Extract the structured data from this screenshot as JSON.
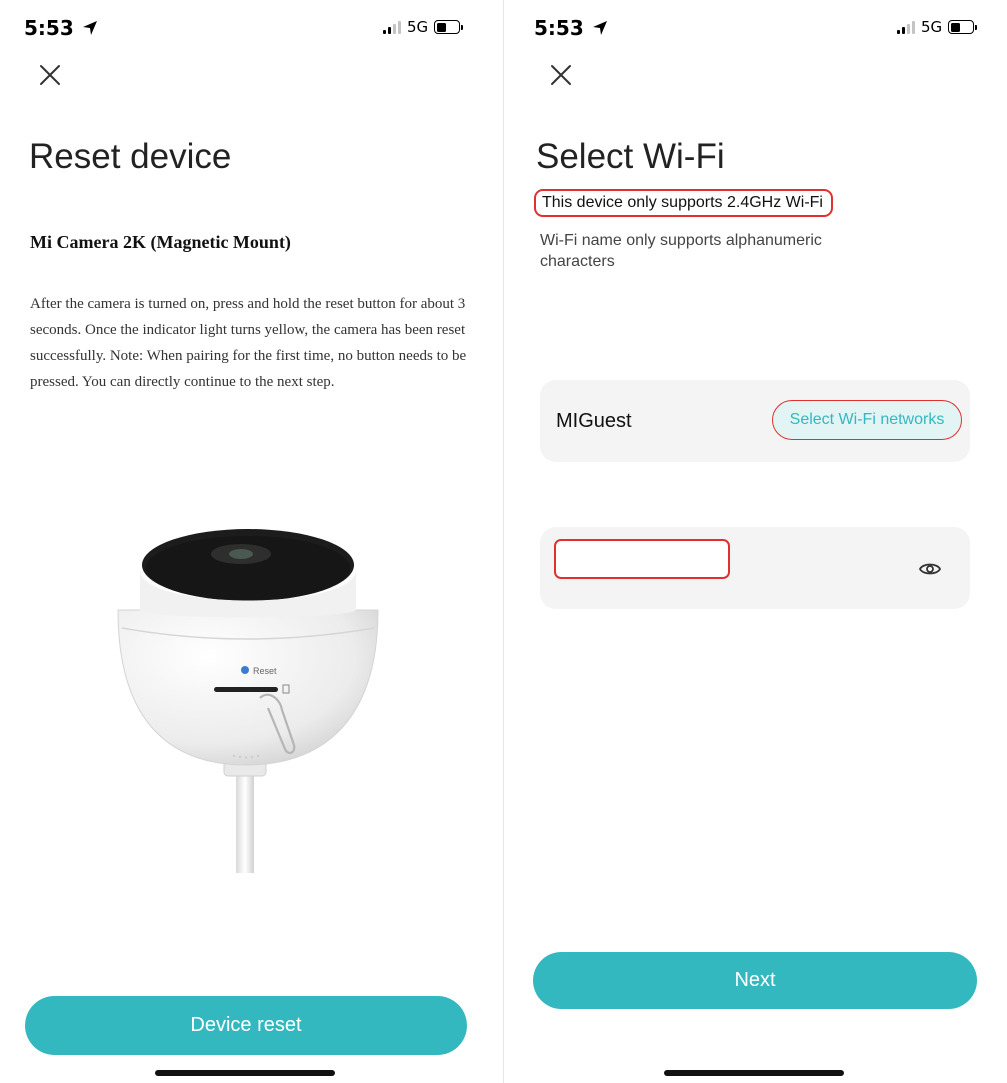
{
  "left_screen": {
    "status_bar": {
      "time": "5:53",
      "network": "5G"
    },
    "title": "Reset device",
    "device_name": "Mi Camera 2K (Magnetic Mount)",
    "instructions": "After the camera is turned on, press and hold the reset button for about 3 seconds. Once the indicator light turns yellow, the camera has been reset successfully.  Note: When pairing for the first time, no button needs to be pressed. You can directly continue to the next step.",
    "illustration": {
      "reset_label": "Reset"
    },
    "primary_button": "Device reset"
  },
  "right_screen": {
    "status_bar": {
      "time": "5:53",
      "network": "5G"
    },
    "title": "Select Wi-Fi",
    "subtitle": "This device only supports 2.4GHz Wi-Fi",
    "note": "Wi-Fi name only supports alphanumeric characters",
    "network": {
      "name": "MIGuest",
      "select_button": "Select Wi-Fi networks"
    },
    "password": {
      "value": ""
    },
    "primary_button": "Next"
  },
  "colors": {
    "accent": "#34b8bf",
    "highlight_outline": "#e03030",
    "card_background": "#f4f4f4"
  },
  "icons": [
    "location-arrow-icon",
    "signal-icon",
    "battery-icon",
    "close-icon",
    "eye-icon"
  ]
}
